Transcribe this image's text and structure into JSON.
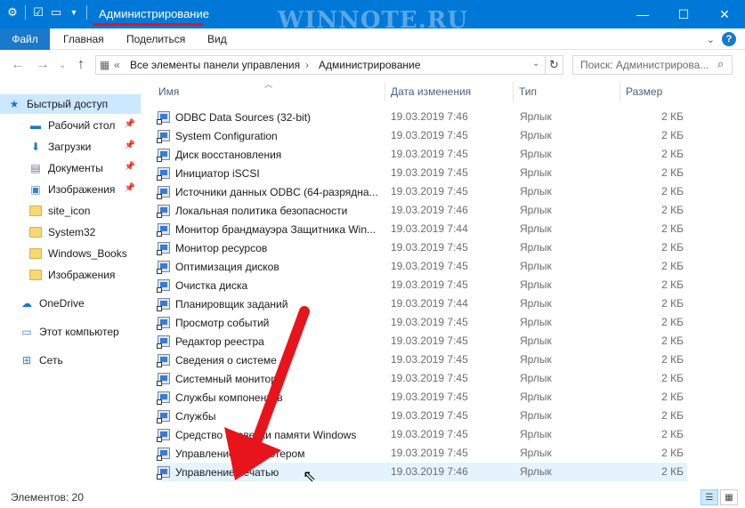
{
  "window": {
    "title": "Администрирование",
    "watermark": "WINNOTE.RU",
    "controls": {
      "minimize": "—",
      "maximize": "☐",
      "close": "✕"
    }
  },
  "ribbon": {
    "file_tab": "Файл",
    "tabs": [
      "Главная",
      "Поделиться",
      "Вид"
    ],
    "help": "?"
  },
  "address": {
    "breadcrumb": [
      "Все элементы панели управления",
      "Администрирование"
    ],
    "search_placeholder": "Поиск: Администрирова..."
  },
  "sidebar": {
    "items": [
      {
        "label": "Быстрый доступ",
        "icon": "star-icon"
      },
      {
        "label": "Рабочий стол",
        "icon": "desktop-icon",
        "pinned": true
      },
      {
        "label": "Загрузки",
        "icon": "download-icon",
        "pinned": true
      },
      {
        "label": "Документы",
        "icon": "documents-icon",
        "pinned": true
      },
      {
        "label": "Изображения",
        "icon": "pictures-icon",
        "pinned": true
      },
      {
        "label": "site_icon",
        "icon": "folder-icon"
      },
      {
        "label": "System32",
        "icon": "folder-icon"
      },
      {
        "label": "Windows_Books",
        "icon": "folder-icon"
      },
      {
        "label": "Изображения",
        "icon": "folder-icon"
      },
      {
        "label": "OneDrive",
        "icon": "cloud-icon"
      },
      {
        "label": "Этот компьютер",
        "icon": "computer-icon"
      },
      {
        "label": "Сеть",
        "icon": "network-icon"
      }
    ]
  },
  "columns": {
    "name": "Имя",
    "date": "Дата изменения",
    "type": "Тип",
    "size": "Размер"
  },
  "files": [
    {
      "name": "ODBC Data Sources (32-bit)",
      "date": "19.03.2019 7:46",
      "type": "Ярлык",
      "size": "2 КБ"
    },
    {
      "name": "System Configuration",
      "date": "19.03.2019 7:45",
      "type": "Ярлык",
      "size": "2 КБ"
    },
    {
      "name": "Диск восстановления",
      "date": "19.03.2019 7:45",
      "type": "Ярлык",
      "size": "2 КБ"
    },
    {
      "name": "Инициатор iSCSI",
      "date": "19.03.2019 7:45",
      "type": "Ярлык",
      "size": "2 КБ"
    },
    {
      "name": "Источники данных ODBC (64-разрядна...",
      "date": "19.03.2019 7:45",
      "type": "Ярлык",
      "size": "2 КБ"
    },
    {
      "name": "Локальная политика безопасности",
      "date": "19.03.2019 7:46",
      "type": "Ярлык",
      "size": "2 КБ"
    },
    {
      "name": "Монитор брандмауэра Защитника Win...",
      "date": "19.03.2019 7:44",
      "type": "Ярлык",
      "size": "2 КБ"
    },
    {
      "name": "Монитор ресурсов",
      "date": "19.03.2019 7:45",
      "type": "Ярлык",
      "size": "2 КБ"
    },
    {
      "name": "Оптимизация дисков",
      "date": "19.03.2019 7:45",
      "type": "Ярлык",
      "size": "2 КБ"
    },
    {
      "name": "Очистка диска",
      "date": "19.03.2019 7:45",
      "type": "Ярлык",
      "size": "2 КБ"
    },
    {
      "name": "Планировщик заданий",
      "date": "19.03.2019 7:44",
      "type": "Ярлык",
      "size": "2 КБ"
    },
    {
      "name": "Просмотр событий",
      "date": "19.03.2019 7:45",
      "type": "Ярлык",
      "size": "2 КБ"
    },
    {
      "name": "Редактор реестра",
      "date": "19.03.2019 7:45",
      "type": "Ярлык",
      "size": "2 КБ"
    },
    {
      "name": "Сведения о системе",
      "date": "19.03.2019 7:45",
      "type": "Ярлык",
      "size": "2 КБ"
    },
    {
      "name": "Системный монитор",
      "date": "19.03.2019 7:45",
      "type": "Ярлык",
      "size": "2 КБ"
    },
    {
      "name": "Службы компонентов",
      "date": "19.03.2019 7:45",
      "type": "Ярлык",
      "size": "2 КБ"
    },
    {
      "name": "Службы",
      "date": "19.03.2019 7:45",
      "type": "Ярлык",
      "size": "2 КБ"
    },
    {
      "name": "Средство проверки памяти Windows",
      "date": "19.03.2019 7:45",
      "type": "Ярлык",
      "size": "2 КБ"
    },
    {
      "name": "Управление компьютером",
      "date": "19.03.2019 7:45",
      "type": "Ярлык",
      "size": "2 КБ"
    },
    {
      "name": "Управление печатью",
      "date": "19.03.2019 7:46",
      "type": "Ярлык",
      "size": "2 КБ"
    }
  ],
  "status": {
    "items_count": "Элементов: 20"
  },
  "colors": {
    "titlebar": "#0078d7",
    "highlight": "#e81123",
    "arrow": "#e8141b",
    "selection": "#cce8ff"
  }
}
